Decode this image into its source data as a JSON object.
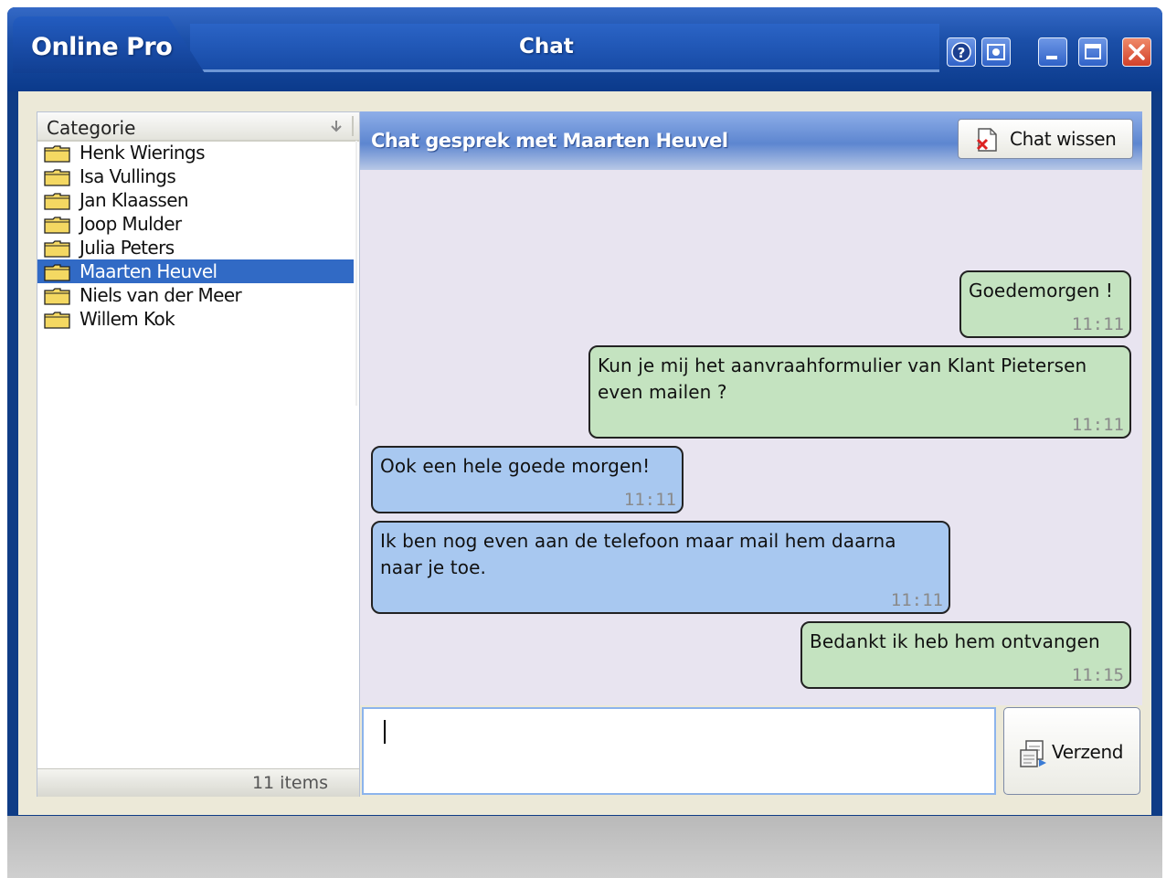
{
  "window": {
    "brand": "Online Pro",
    "title": "Chat",
    "controls": [
      {
        "name": "help-button",
        "icon": "question-icon"
      },
      {
        "name": "screenshot-button",
        "icon": "camera-icon"
      },
      {
        "name": "minimize-button",
        "icon": "minimize-icon"
      },
      {
        "name": "maximize-button",
        "icon": "maximize-icon"
      },
      {
        "name": "close-button",
        "icon": "close-icon"
      }
    ]
  },
  "contacts": {
    "column_header": "Categorie",
    "items": [
      {
        "label": "Henk Wierings",
        "selected": false
      },
      {
        "label": "Isa Vullings",
        "selected": false
      },
      {
        "label": "Jan Klaassen",
        "selected": false
      },
      {
        "label": "Joop Mulder",
        "selected": false
      },
      {
        "label": "Julia Peters",
        "selected": false
      },
      {
        "label": "Maarten Heuvel",
        "selected": true
      },
      {
        "label": "Niels van der Meer",
        "selected": false
      },
      {
        "label": "Willem Kok",
        "selected": false
      }
    ],
    "footer_count": "11 items"
  },
  "chat": {
    "title": "Chat gesprek met Maarten Heuvel",
    "clear_button_label": "Chat wissen",
    "messages": [
      {
        "direction": "sent",
        "text": "Goedemorgen !",
        "time": "11:11"
      },
      {
        "direction": "sent",
        "text": "Kun je mij het aanvraahformulier van Klant Pietersen\neven mailen ?",
        "time": "11:11"
      },
      {
        "direction": "received",
        "text": "Ook een hele goede morgen!",
        "time": "11:11"
      },
      {
        "direction": "received",
        "text": "Ik ben nog even aan de telefoon maar mail hem daarna\nnaar je toe.",
        "time": "11:11"
      },
      {
        "direction": "sent",
        "text": "Bedankt ik heb hem ontvangen",
        "time": "11:15"
      }
    ],
    "input_value": "",
    "send_button_label": "Verzend"
  },
  "colors": {
    "sent_bubble": "#c4e3c0",
    "received_bubble": "#a8c8f0",
    "selection": "#316ac5",
    "titlebar": "#1b4fa8"
  }
}
